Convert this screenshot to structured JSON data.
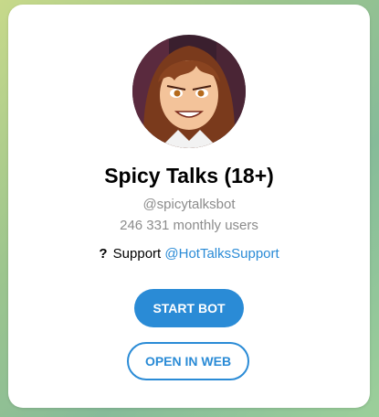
{
  "bot": {
    "name": "Spicy Talks (18+)",
    "username": "@spicytalksbot",
    "monthly_users": "246 331 monthly users",
    "support_prefix": "Support",
    "support_link": "@HotTalksSupport",
    "support_icon": "question-mark-icon"
  },
  "buttons": {
    "start": "START BOT",
    "open_web": "OPEN IN WEB"
  },
  "colors": {
    "accent": "#2a8bd6",
    "secondary_text": "#8c8c8c"
  }
}
